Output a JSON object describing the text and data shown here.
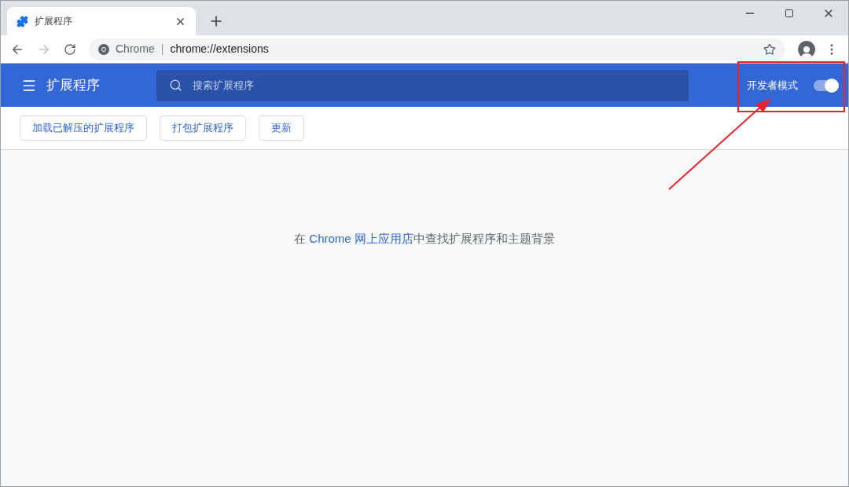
{
  "tabs": [
    {
      "title": "扩展程序",
      "selected": true
    }
  ],
  "address_bar": {
    "chip": "Chrome",
    "separator": "|",
    "url": "chrome://extensions"
  },
  "header": {
    "title": "扩展程序",
    "search": {
      "placeholder": "搜索扩展程序"
    },
    "developer_mode": {
      "label": "开发者模式",
      "on": true
    }
  },
  "actions": [
    "加载已解压的扩展程序",
    "打包扩展程序",
    "更新"
  ],
  "empty_state": {
    "prefix": "在 ",
    "link": "Chrome 网上应用店",
    "suffix": "中查找扩展程序和主题背景"
  }
}
